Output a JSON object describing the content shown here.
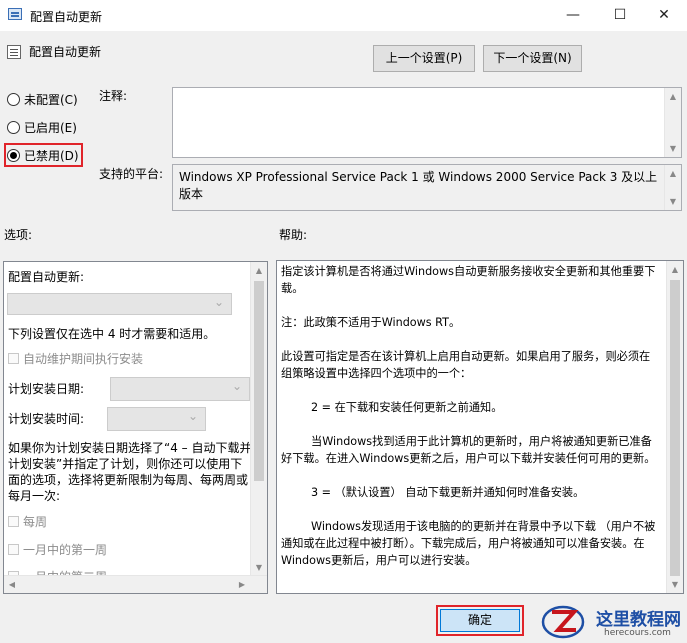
{
  "window": {
    "title": "配置自动更新",
    "minimize": "—",
    "maximize": "☐",
    "close": "✕"
  },
  "header": {
    "policy_name": "配置自动更新",
    "prev_button": "上一个设置(P)",
    "next_button": "下一个设置(N)"
  },
  "state": {
    "options": [
      {
        "label": "未配置(C)",
        "selected": false
      },
      {
        "label": "已启用(E)",
        "selected": false
      },
      {
        "label": "已禁用(D)",
        "selected": true
      }
    ]
  },
  "comment": {
    "label": "注释:",
    "value": ""
  },
  "platform": {
    "label": "支持的平台:",
    "value": "Windows XP Professional Service Pack 1 或 Windows 2000 Service Pack 3 及以上版本"
  },
  "options_section": {
    "title": "选项:",
    "config_label": "配置自动更新:",
    "config_value": "",
    "note": "下列设置仅在选中 4 时才需要和适用。",
    "maintenance_checkbox": "自动维护期间执行安装",
    "schedule_day_label": "计划安装日期:",
    "schedule_time_label": "计划安装时间:",
    "schedule_description": "如果你为计划安装日期选择了“4 – 自动下载并计划安装”并指定了计划，则你还可以使用下面的选项，选择将更新限制为每周、每两周或每月一次:",
    "weekly": "每周",
    "first_week": "一月中的第一周",
    "second_week": "一月中的第二周"
  },
  "help_section": {
    "title": "帮助:",
    "paragraphs": [
      "指定该计算机是否将通过Windows自动更新服务接收安全更新和其他重要下载。",
      "注：此政策不适用于Windows RT。",
      "此设置可指定是否在该计算机上启用自动更新。如果启用了服务，则必须在组策略设置中选择四个选项中的一个：",
      "2 = 在下载和安装任何更新之前通知。",
      "当Windows找到适用于此计算机的更新时，用户将被通知更新已准备好下载。在进入Windows更新之后，用户可以下载并安装任何可用的更新。",
      "3 = （默认设置） 自动下载更新并通知何时准备安装。",
      "Windows发现适用于该电脑的的更新并在背景中予以下载 （用户不被通知或在此过程中被打断）。下载完成后，用户将被通知可以准备安装。在Windows更新后，用户可以进行安装。"
    ]
  },
  "footer": {
    "ok_button": "确定"
  },
  "watermark": {
    "name": "这里教程网",
    "url": "herecours.com"
  },
  "colors": {
    "highlight": "#e0242a",
    "ok_accent": "#0078d7"
  }
}
